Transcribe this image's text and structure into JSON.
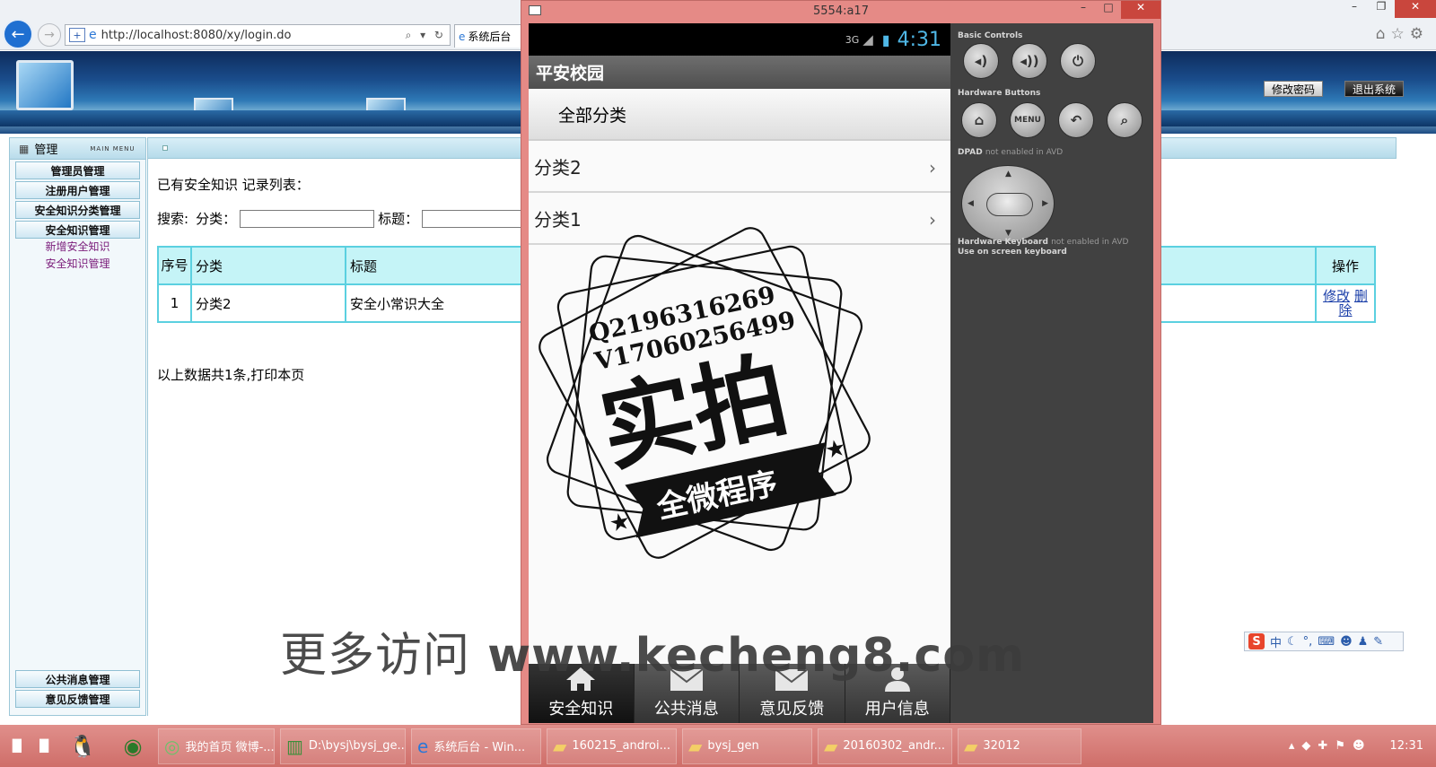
{
  "browser": {
    "url": "http://localhost:8080/xy/login.do",
    "tab_title": "系统后台"
  },
  "header": {
    "change_password": "修改密码",
    "logout": "退出系统"
  },
  "sidebar": {
    "title": "管理",
    "subtitle": "MAIN MENU",
    "items": [
      {
        "label": "管理员管理"
      },
      {
        "label": "注册用户管理"
      },
      {
        "label": "安全知识分类管理"
      },
      {
        "label": "安全知识管理"
      }
    ],
    "subitems": [
      {
        "label": "新增安全知识"
      },
      {
        "label": "安全知识管理"
      }
    ],
    "bottom_items": [
      {
        "label": "公共消息管理"
      },
      {
        "label": "意见反馈管理"
      }
    ]
  },
  "main": {
    "heading": "已有安全知识 记录列表：",
    "search_label": "搜索:",
    "category_label": "分类：",
    "title_label": "标题：",
    "category_value": "",
    "title_value": "",
    "table": {
      "headers": {
        "no": "序号",
        "category": "分类",
        "title": "标题",
        "op": "操作"
      },
      "rows": [
        {
          "no": "1",
          "category": "分类2",
          "title": "安全小常识大全",
          "edit": "修改",
          "delete": "删除"
        }
      ]
    },
    "summary": "以上数据共1条,打印本页"
  },
  "emulator": {
    "window_title": "5554:a17",
    "status_network": "3G",
    "status_time": "4:31",
    "app_title": "平安校园",
    "list_header": "全部分类",
    "categories": [
      {
        "label": "分类2"
      },
      {
        "label": "分类1"
      }
    ],
    "tabs": [
      {
        "label": "安全知识",
        "icon": "home-icon"
      },
      {
        "label": "公共消息",
        "icon": "mail-icon"
      },
      {
        "label": "意见反馈",
        "icon": "mail-icon"
      },
      {
        "label": "用户信息",
        "icon": "user-icon"
      }
    ],
    "panel": {
      "basic_controls": "Basic Controls",
      "hardware_buttons": "Hardware Buttons",
      "menu_label": "MENU",
      "dpad_label": "DPAD",
      "dpad_note": "not enabled in AVD",
      "keyboard_label": "Hardware Keyboard",
      "keyboard_note": "not enabled in AVD",
      "keyboard_note2": "Use on screen keyboard"
    }
  },
  "watermark": {
    "contact_q": "Q2196316269",
    "contact_v": "V17060256499",
    "stamp_main": "实拍",
    "stamp_sub": "全微程序",
    "promo_cn": "更多访问",
    "promo_url": "www.kecheng8.com"
  },
  "ime": {
    "mode": "中"
  },
  "taskbar": {
    "tasks": [
      {
        "label": "我的首页 微博-..."
      },
      {
        "label": "D:\\bysj\\bysj_ge..."
      },
      {
        "label": "系统后台 - Win..."
      },
      {
        "label": "160215_androi..."
      },
      {
        "label": "bysj_gen"
      },
      {
        "label": "20160302_andr..."
      },
      {
        "label": "32012"
      }
    ],
    "clock": "12:31"
  },
  "colors": {
    "table_border": "#5bd0e0",
    "table_header_bg": "#c5f4f7",
    "emulator_frame": "#e58a86",
    "taskbar": "#d97f7a",
    "status_time": "#4fb7e6"
  }
}
